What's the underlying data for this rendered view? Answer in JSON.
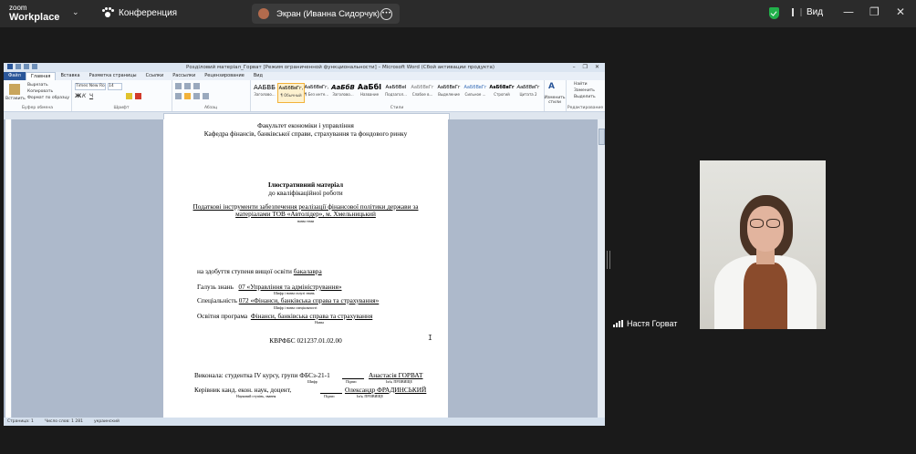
{
  "zoom": {
    "logo_top": "zoom",
    "logo_bottom": "Workplace",
    "meeting_label": "Конференция",
    "share_label": "Экран (Иванна Сидорчук)",
    "view_label": "Вид",
    "controls": {
      "minimize": "—",
      "restore": "❐",
      "close": "✕"
    }
  },
  "word": {
    "window_title": "Розділовий матеріал_Горват [Режим ограниченной функциональности] – Microsoft Word (Сбой активации продукта)",
    "tabs": [
      "Файл",
      "Главная",
      "Вставка",
      "Разметка страницы",
      "Ссылки",
      "Рассылки",
      "Рецензирование",
      "Вид"
    ],
    "active_tab": "Главная",
    "clipboard": {
      "paste": "Вставить",
      "cut": "Вырезать",
      "copy": "Копировать",
      "format": "Формат по образцу",
      "label": "Буфер обмена"
    },
    "font": {
      "name": "Times New Ro",
      "size": "14",
      "label": "Шрифт"
    },
    "paragraph_label": "Абзац",
    "styles": [
      {
        "preview": "ААБВБ",
        "name": "Заголово..."
      },
      {
        "preview": "АаБбВвГг,",
        "name": "¶ Обычный"
      },
      {
        "preview": "АаБбВвГг,",
        "name": "¶ Без инте..."
      },
      {
        "preview": "АаБбВ",
        "name": "Заголово..."
      },
      {
        "preview": "АаБбI",
        "name": "Название"
      },
      {
        "preview": "АаБбВеI",
        "name": "Подзагол..."
      },
      {
        "preview": "АаБбВвГг",
        "name": "Слабое в..."
      },
      {
        "preview": "АаБбВвГг",
        "name": "Выделение"
      },
      {
        "preview": "АаБбВвГг",
        "name": "Сильное ..."
      },
      {
        "preview": "АаБбВвГг",
        "name": "Строгий"
      },
      {
        "preview": "АаБбВвГг",
        "name": "Цитата 2"
      }
    ],
    "styles_label": "Стили",
    "change_styles": "Изменить стили",
    "editing": {
      "find": "Найти",
      "replace": "Заменить",
      "select": "Выделить",
      "label": "Редактирование"
    },
    "status": {
      "page": "Страница: 1",
      "words": "Число слов: 1 281",
      "lang": "украинский"
    }
  },
  "doc": {
    "faculty": "Факультет економіки і управління",
    "department": "Кафедра фінансів, банківської справи, страхування та фондового ринку",
    "material_title": "Ілюстративний матеріал",
    "material_sub": "до кваліфікаційної роботи",
    "topic_line1": "Податкові інструменти забезпечення реалізації фінансової політики держави за",
    "topic_line2": "матеріалами ТОВ «Автолідер», м. Хмельницький",
    "topic_caption": "назва теми",
    "degree_prefix": "на здобуття ступеня вищої освіти",
    "degree_value": "бакалавра",
    "field_prefix": "Галузь знань",
    "field_value": "07  «Управління та адміністрування»",
    "field_caption": "Шифр і назва галузі знань",
    "spec_prefix": "Спеціальність",
    "spec_value": "072 «Фінанси, банківська справа та страхування»",
    "spec_caption": "Шифр і назва спеціальності",
    "program_prefix": "Освітня програма",
    "program_value": "Фінанси, банківська справа та страхування",
    "program_caption": "Назва",
    "code": "КВРФБС 021237.01.02.00",
    "performer_prefix": "Виконала: студентка IV курсу, групи ФБСз-21-1",
    "performer_name": "Анастасія ГОРВАТ",
    "caption_code": "Шифр",
    "caption_sign": "Підпис",
    "caption_name": "Ім'я, ПРІЗВИЩЕ",
    "supervisor_prefix": "Керівник канд. екон. наук, доцент,",
    "supervisor_name": "Олександр ФРАДИНСЬКИЙ",
    "caption_degree": "Науковий ступінь, звання"
  },
  "participant": {
    "name": "Настя Горват"
  },
  "colors": {
    "zoom_bar": "#2b2b2b",
    "word_file_tab": "#2a5699",
    "shield": "#21b04a"
  }
}
